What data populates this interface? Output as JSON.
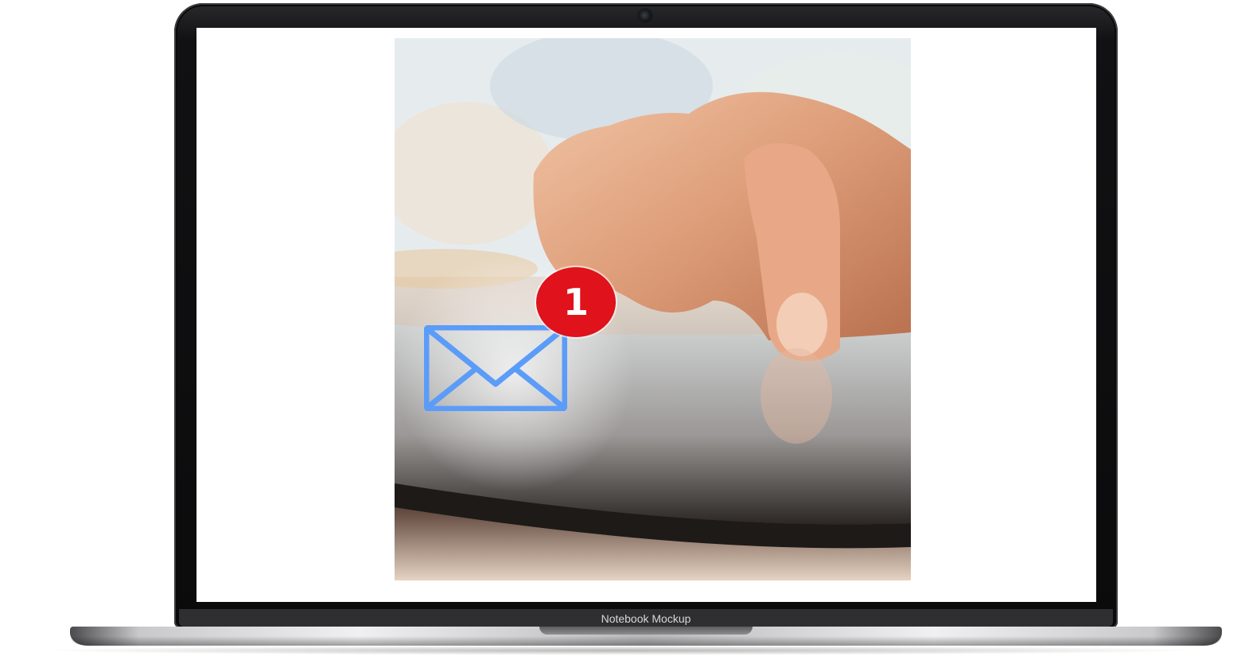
{
  "device": {
    "brand_label": "Notebook Mockup"
  },
  "screen_content": {
    "notification": {
      "count": "1",
      "icon": "envelope-icon",
      "badge_color": "#e0121b",
      "icon_color": "#5b9cf8"
    }
  }
}
